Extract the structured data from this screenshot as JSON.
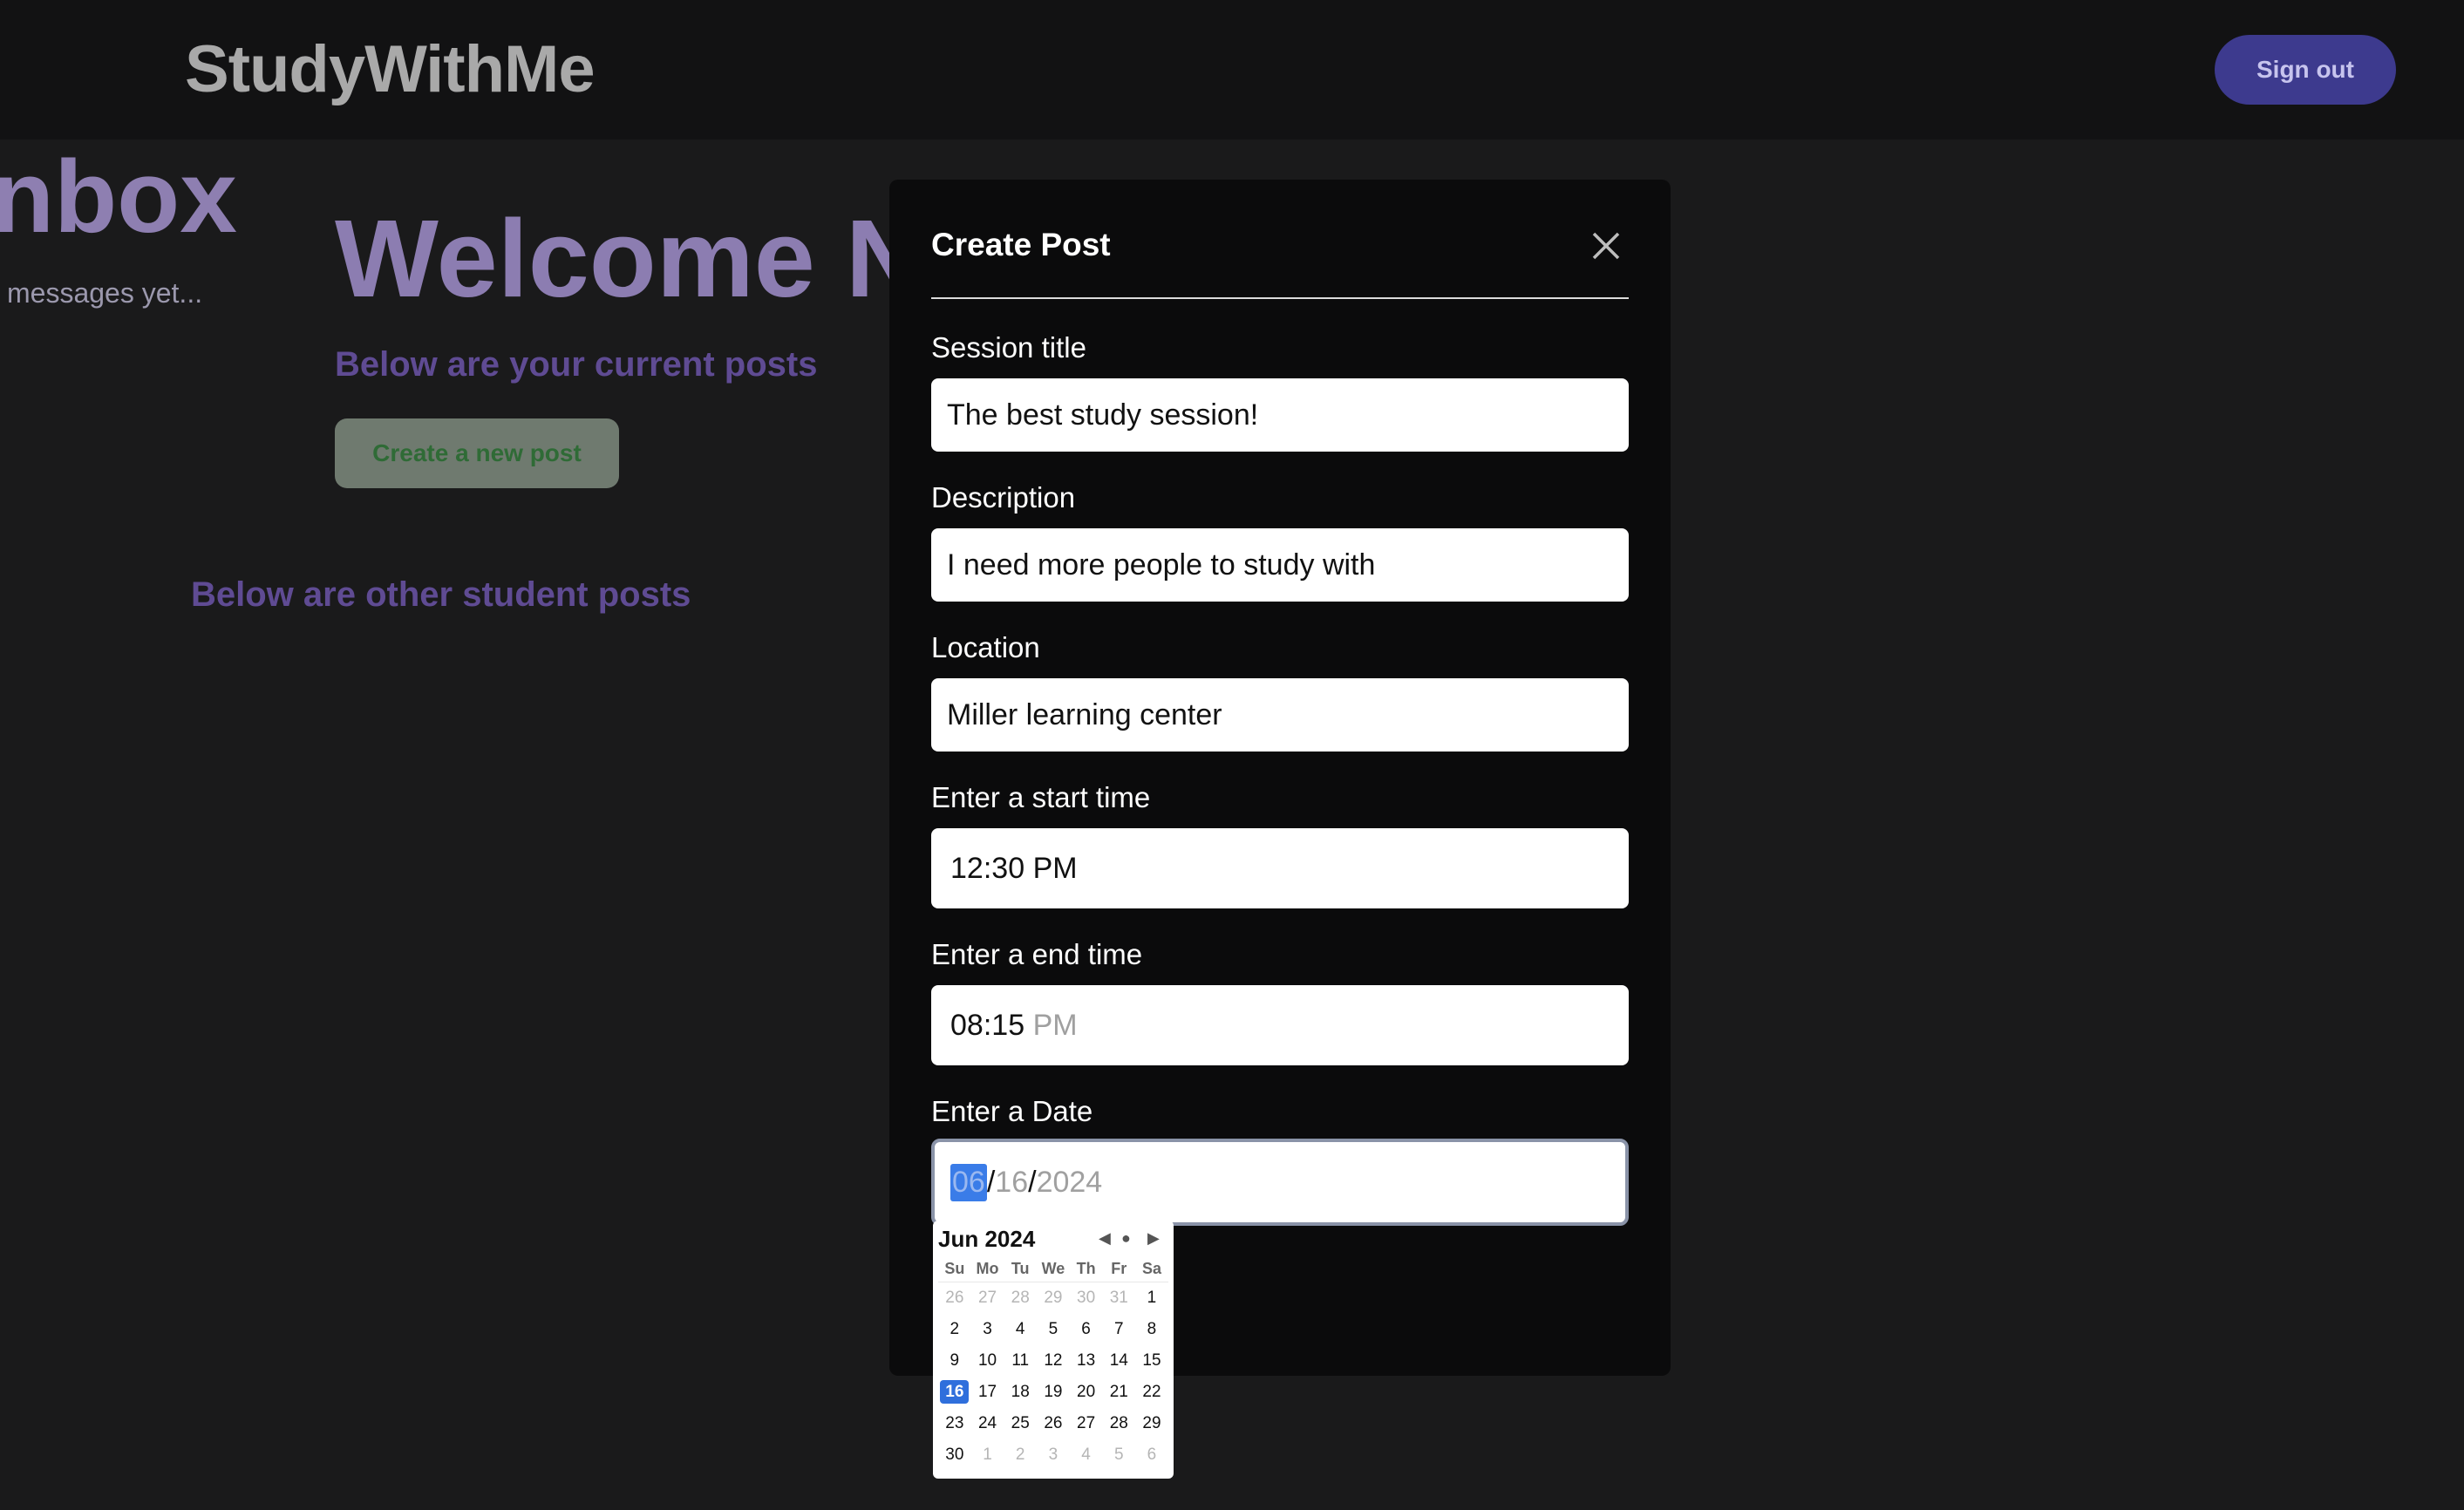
{
  "header": {
    "brand": "StudyWithMe",
    "signout_label": "Sign out"
  },
  "inbox": {
    "title": "nbox",
    "empty_text": "messages yet..."
  },
  "main": {
    "welcome": "Welcome N",
    "current_posts_heading": "Below are your current posts",
    "create_button": "Create a new post",
    "other_posts_heading": "Below are other student posts"
  },
  "modal": {
    "title": "Create Post",
    "session_title": {
      "label": "Session title",
      "value": "The best study session!"
    },
    "description": {
      "label": "Description",
      "value": "I need more people to study with"
    },
    "location": {
      "label": "Location",
      "value": "Miller learning center"
    },
    "start_time": {
      "label": "Enter a start time",
      "hour": "12",
      "minute": "30",
      "ampm": "PM"
    },
    "end_time": {
      "label": "Enter a end time",
      "hour": "08",
      "minute": "15",
      "ampm": "PM"
    },
    "date": {
      "label": "Enter a Date",
      "month": "06",
      "day": "16",
      "year": "2024"
    }
  },
  "calendar": {
    "month_label": "Jun 2024",
    "nav": {
      "prev": "◀",
      "today": "●",
      "next": "▶"
    },
    "weekdays": [
      "Su",
      "Mo",
      "Tu",
      "We",
      "Th",
      "Fr",
      "Sa"
    ],
    "weeks": [
      [
        "26",
        "27",
        "28",
        "29",
        "30",
        "31",
        "1"
      ],
      [
        "2",
        "3",
        "4",
        "5",
        "6",
        "7",
        "8"
      ],
      [
        "9",
        "10",
        "11",
        "12",
        "13",
        "14",
        "15"
      ],
      [
        "16",
        "17",
        "18",
        "19",
        "20",
        "21",
        "22"
      ],
      [
        "23",
        "24",
        "25",
        "26",
        "27",
        "28",
        "29"
      ],
      [
        "30",
        "1",
        "2",
        "3",
        "4",
        "5",
        "6"
      ]
    ],
    "out_of_month": [
      [
        0,
        0
      ],
      [
        0,
        1
      ],
      [
        0,
        2
      ],
      [
        0,
        3
      ],
      [
        0,
        4
      ],
      [
        0,
        5
      ],
      [
        5,
        1
      ],
      [
        5,
        2
      ],
      [
        5,
        3
      ],
      [
        5,
        4
      ],
      [
        5,
        5
      ],
      [
        5,
        6
      ]
    ],
    "selected": [
      3,
      0
    ]
  }
}
